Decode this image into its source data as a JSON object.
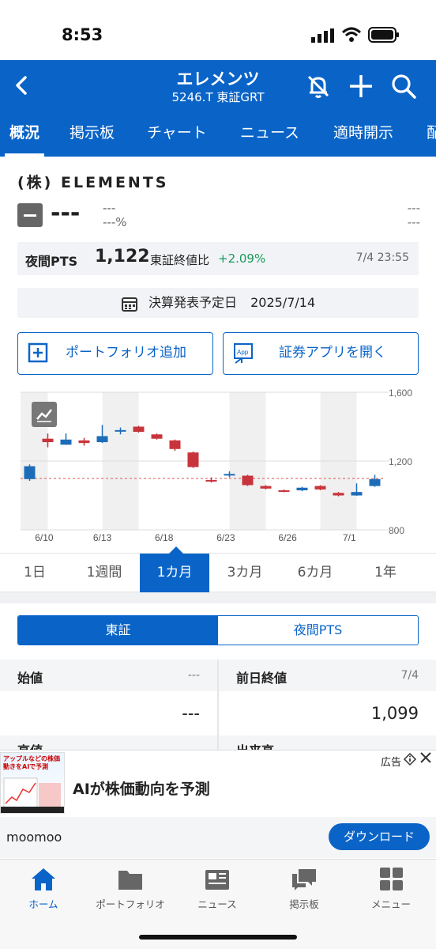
{
  "status": {
    "time": "8:53"
  },
  "header": {
    "title": "エレメンツ",
    "subtitle": "5246.T 東証GRT"
  },
  "tabs": [
    "概況",
    "掲示板",
    "チャート",
    "ニュース",
    "適時開示",
    "配"
  ],
  "company": {
    "name": "(株) ELEMENTS"
  },
  "price": {
    "value": "---",
    "change": "---",
    "change_pct": "---%",
    "right1": "---",
    "right2": "---"
  },
  "pts": {
    "label": "夜間PTS",
    "price": "1,122",
    "compare_label": "東証終値比",
    "change": "+2.09%",
    "datetime": "7/4 23:55"
  },
  "earnings": {
    "label": "決算発表予定日",
    "date": "2025/7/14"
  },
  "buttons": {
    "portfolio": "ポートフォリオ追加",
    "app": "証券アプリを開く",
    "app_icon_text": "App"
  },
  "chart_data": {
    "type": "candlestick",
    "x_labels": [
      "6/10",
      "6/13",
      "6/18",
      "6/23",
      "6/26",
      "7/1"
    ],
    "y_ticks": [
      1600,
      1200,
      800
    ],
    "ylim": [
      800,
      1600
    ],
    "reference_line": 1099,
    "candles": [
      {
        "o": 1095,
        "c": 1170,
        "h": 1180,
        "l": 1085,
        "up": true
      },
      {
        "o": 1330,
        "c": 1310,
        "h": 1360,
        "l": 1280,
        "up": false
      },
      {
        "o": 1295,
        "c": 1325,
        "h": 1360,
        "l": 1295,
        "up": true
      },
      {
        "o": 1320,
        "c": 1305,
        "h": 1335,
        "l": 1290,
        "up": false
      },
      {
        "o": 1310,
        "c": 1345,
        "h": 1410,
        "l": 1305,
        "up": true
      },
      {
        "o": 1375,
        "c": 1380,
        "h": 1395,
        "l": 1355,
        "up": true
      },
      {
        "o": 1400,
        "c": 1370,
        "h": 1405,
        "l": 1365,
        "up": false
      },
      {
        "o": 1355,
        "c": 1330,
        "h": 1360,
        "l": 1325,
        "up": false
      },
      {
        "o": 1320,
        "c": 1270,
        "h": 1325,
        "l": 1260,
        "up": false
      },
      {
        "o": 1250,
        "c": 1165,
        "h": 1255,
        "l": 1160,
        "up": false
      },
      {
        "o": 1090,
        "c": 1085,
        "h": 1105,
        "l": 1075,
        "up": false
      },
      {
        "o": 1120,
        "c": 1125,
        "h": 1140,
        "l": 1105,
        "up": true
      },
      {
        "o": 1115,
        "c": 1060,
        "h": 1120,
        "l": 1055,
        "up": false
      },
      {
        "o": 1055,
        "c": 1040,
        "h": 1060,
        "l": 1035,
        "up": false
      },
      {
        "o": 1030,
        "c": 1025,
        "h": 1035,
        "l": 1018,
        "up": false
      },
      {
        "o": 1030,
        "c": 1045,
        "h": 1050,
        "l": 1025,
        "up": true
      },
      {
        "o": 1055,
        "c": 1035,
        "h": 1060,
        "l": 1030,
        "up": false
      },
      {
        "o": 1015,
        "c": 1000,
        "h": 1020,
        "l": 995,
        "up": false
      },
      {
        "o": 1000,
        "c": 1020,
        "h": 1070,
        "l": 998,
        "up": true
      },
      {
        "o": 1055,
        "c": 1095,
        "h": 1120,
        "l": 1050,
        "up": true
      }
    ]
  },
  "periods": [
    "1日",
    "1週間",
    "1カ月",
    "3カ月",
    "6カ月",
    "1年"
  ],
  "market_toggle": {
    "left": "東証",
    "right": "夜間PTS"
  },
  "grid": {
    "open_label": "始値",
    "open_sub": "---",
    "open_value": "---",
    "prev_label": "前日終値",
    "prev_date": "7/4",
    "prev_value": "1,099",
    "high_label": "高値",
    "volume_label": "出来高"
  },
  "ad": {
    "label": "広告",
    "title": "AIが株価動向を予測",
    "brand": "moomoo",
    "cta": "ダウンロード",
    "image_text": "アップルなどの株価動きをAIで予測"
  },
  "bottom_nav": [
    "ホーム",
    "ポートフォリオ",
    "ニュース",
    "掲示板",
    "メニュー"
  ],
  "colors": {
    "brand": "#0a64c8",
    "up": "#1c6cb8",
    "down": "#c8343b",
    "positive": "#1a9a5c"
  }
}
